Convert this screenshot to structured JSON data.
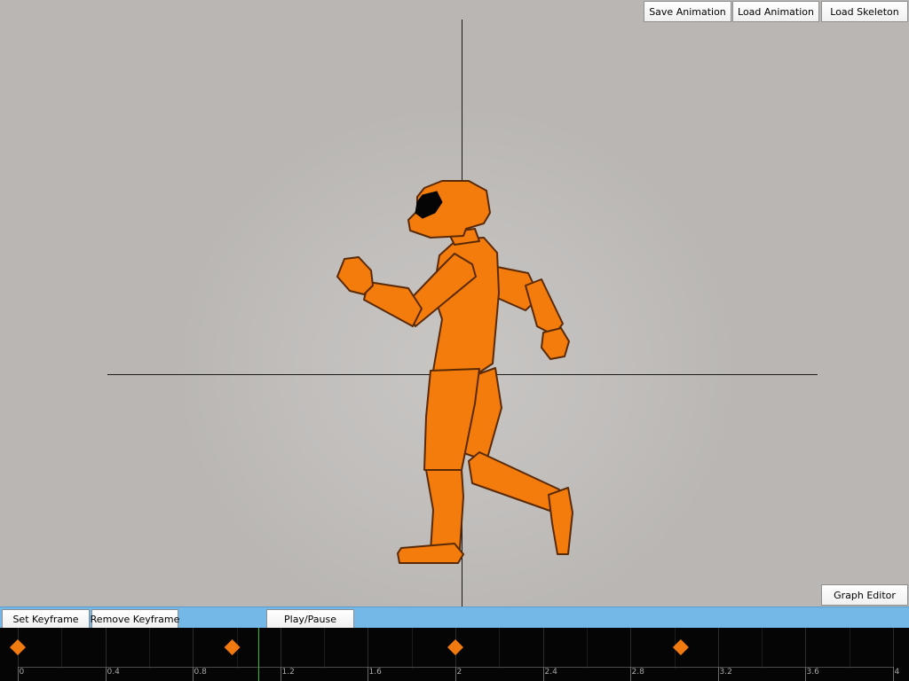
{
  "toolbar_top": {
    "save_animation": "Save Animation",
    "load_animation": "Load Animation",
    "load_skeleton": "Load Skeleton"
  },
  "graph_editor": "Graph Editor",
  "toolbar_bottom": {
    "set_keyframe": "Set Keyframe",
    "remove_keyframe": "Remove Keyframe",
    "play_pause": "Play/Pause"
  },
  "timeline": {
    "ticks": [
      "0",
      "0.4",
      "0.8",
      "1.2",
      "1.6",
      "2",
      "2.4",
      "2.8",
      "3.2",
      "3.6",
      "4"
    ],
    "keyframes": [
      0,
      0.98,
      2.0,
      3.03
    ],
    "playhead": 1.1,
    "duration": 4,
    "colors": {
      "keyframe": "#f07a10",
      "playhead": "#22c022",
      "grid": "#3a3a3a"
    }
  },
  "colors": {
    "figure": "#f47c0c",
    "figure_outline": "#5a2a06",
    "toolbar": "#74b8e8"
  }
}
